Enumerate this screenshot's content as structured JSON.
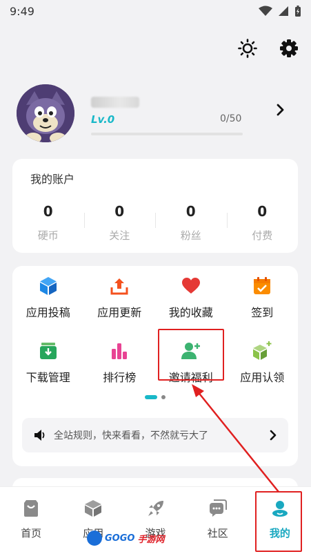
{
  "status_bar": {
    "time": "9:49"
  },
  "profile": {
    "level": "Lv.0",
    "xp": "0/50",
    "xp_fraction": 0
  },
  "account": {
    "title": "我的账户",
    "stats": [
      {
        "value": "0",
        "label": "硬币"
      },
      {
        "value": "0",
        "label": "关注"
      },
      {
        "value": "0",
        "label": "粉丝"
      },
      {
        "value": "0",
        "label": "付费"
      }
    ]
  },
  "features": [
    {
      "label": "应用投稿",
      "icon": "cube-icon",
      "color": "#1e88e5"
    },
    {
      "label": "应用更新",
      "icon": "upload-icon",
      "color": "#f4511e"
    },
    {
      "label": "我的收藏",
      "icon": "heart-icon",
      "color": "#e53935"
    },
    {
      "label": "签到",
      "icon": "calendar-icon",
      "color": "#fb8c00"
    },
    {
      "label": "下载管理",
      "icon": "download-box-icon",
      "color": "#26a65b"
    },
    {
      "label": "排行榜",
      "icon": "bar-chart-icon",
      "color": "#e84393"
    },
    {
      "label": "邀请福利",
      "icon": "add-user-icon",
      "color": "#3cb371"
    },
    {
      "label": "应用认领",
      "icon": "cube-plus-icon",
      "color": "#8bc34a"
    }
  ],
  "notice": {
    "text": "全站规则，快来看看，不然就亏大了"
  },
  "nav": [
    {
      "label": "首页",
      "icon": "bag-icon"
    },
    {
      "label": "应用",
      "icon": "cube-icon"
    },
    {
      "label": "游戏",
      "icon": "rocket-icon"
    },
    {
      "label": "社区",
      "icon": "chat-icon"
    },
    {
      "label": "我的",
      "icon": "user-icon"
    }
  ],
  "watermark": {
    "brand": "GOGO",
    "sub": "手游网"
  },
  "colors": {
    "accent": "#19b8c8",
    "highlight": "#e02020"
  }
}
